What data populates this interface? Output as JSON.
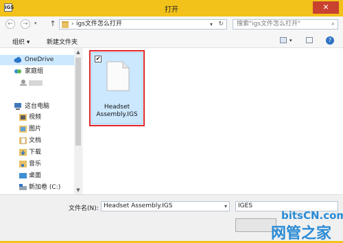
{
  "window": {
    "app_icon": "IGS",
    "title": "打开",
    "close": "✕"
  },
  "address": {
    "back_glyph": "←",
    "forward_glyph": "→",
    "up_glyph": "↑",
    "separator": "›",
    "path": "igs文件怎么打开",
    "search_placeholder": "搜索\"igs文件怎么打开\""
  },
  "toolbar": {
    "organize": "组织 ▾",
    "new_folder": "新建文件夹",
    "help": "?"
  },
  "sidebar": {
    "items": [
      {
        "label": "OneDrive"
      },
      {
        "label": "家庭组"
      },
      {
        "label": ""
      },
      {
        "label": "这台电脑"
      },
      {
        "label": "视频"
      },
      {
        "label": "图片"
      },
      {
        "label": "文档"
      },
      {
        "label": "下载"
      },
      {
        "label": "音乐"
      },
      {
        "label": "桌面"
      },
      {
        "label": "新加卷 (C:)"
      }
    ]
  },
  "files": [
    {
      "name": "Headset\nAssembly.IGS",
      "checked": true
    }
  ],
  "bottom": {
    "filename_label": "文件名(N):",
    "filename_value": "Headset Assembly.IGS",
    "filetype_value": "IGES"
  },
  "watermark": {
    "line1": "bitsCN.com",
    "line2": "网管之家"
  },
  "colors": {
    "titlebar": "#f2c21a",
    "selection": "#cce8ff",
    "highlight_border": "#e0242b",
    "close": "#c9412f"
  }
}
